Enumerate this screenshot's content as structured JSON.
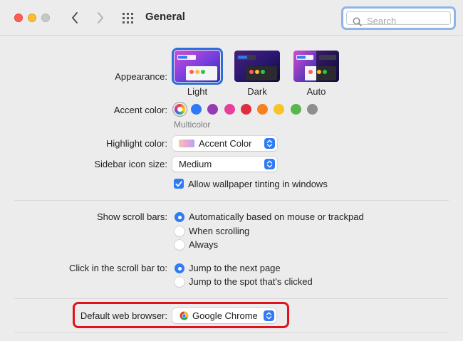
{
  "toolbar": {
    "title": "General",
    "search_placeholder": "Search"
  },
  "appearance": {
    "label": "Appearance:",
    "options": [
      "Light",
      "Dark",
      "Auto"
    ],
    "selected": "Light"
  },
  "accent": {
    "label": "Accent color:",
    "selected_name": "Multicolor",
    "colors": [
      "multicolor",
      "#2f7bf5",
      "#953bb3",
      "#e8409a",
      "#df2f3e",
      "#f5811f",
      "#f7c325",
      "#58b64e",
      "#8e8e8e"
    ]
  },
  "highlight": {
    "label": "Highlight color:",
    "value": "Accent Color"
  },
  "sidebar_icon_size": {
    "label": "Sidebar icon size:",
    "value": "Medium"
  },
  "wallpaper_tinting": {
    "label": "Allow wallpaper tinting in windows",
    "checked": true
  },
  "scroll_bars": {
    "label": "Show scroll bars:",
    "options": [
      "Automatically based on mouse or trackpad",
      "When scrolling",
      "Always"
    ],
    "selected": 0
  },
  "click_scroll": {
    "label": "Click in the scroll bar to:",
    "options": [
      "Jump to the next page",
      "Jump to the spot that's clicked"
    ],
    "selected": 0
  },
  "default_browser": {
    "label": "Default web browser:",
    "value": "Google Chrome"
  },
  "colors": {
    "accent_blue": "#2f7bf5",
    "highlight_red": "#e0131c"
  }
}
